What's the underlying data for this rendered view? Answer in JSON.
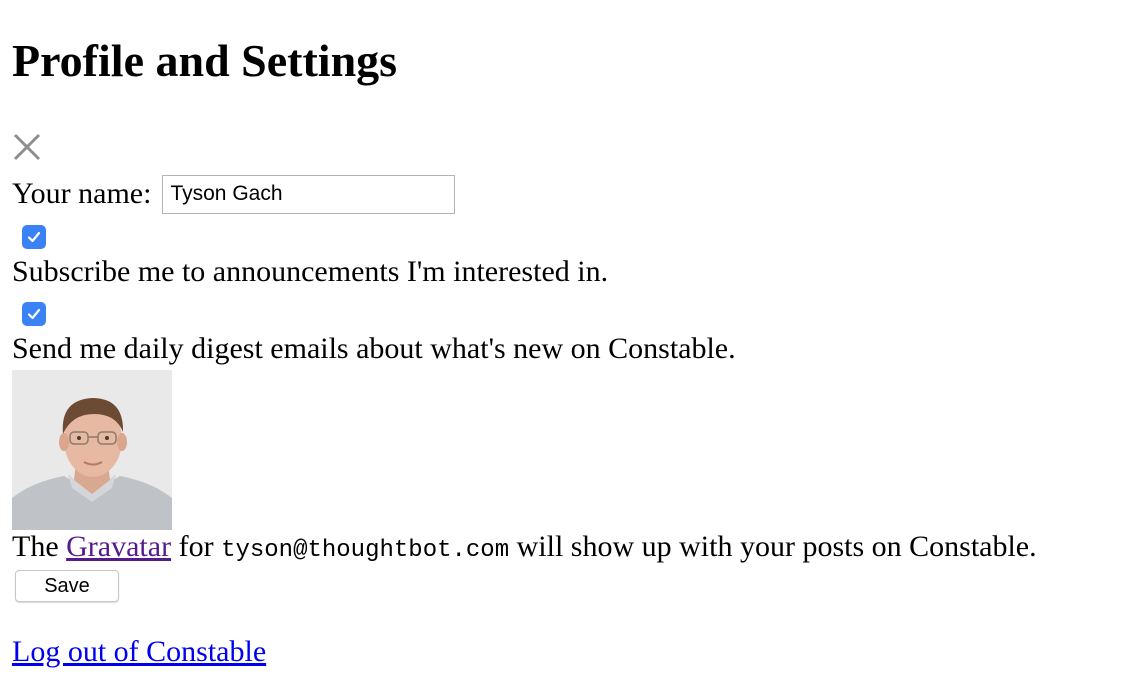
{
  "page": {
    "title": "Profile and Settings"
  },
  "close": {
    "icon": "close-icon"
  },
  "profile_form": {
    "name_label": "Your name:",
    "name_value": "Tyson Gach",
    "announcements_checked": true,
    "announcements_label": "Subscribe me to announcements I'm interested in.",
    "digest_checked": true,
    "digest_label": "Send me daily digest emails about what's new on Constable.",
    "avatar_alt": "avatar",
    "gravatar_prefix": "The",
    "gravatar_link": "Gravatar",
    "gravatar_middle": "for",
    "email": "tyson@thoughtbot.com",
    "gravatar_suffix": "will show up with your posts on Constable.",
    "save_label": "Save"
  },
  "logout": {
    "label": "Log out of Constable"
  },
  "colors": {
    "checkbox_accent": "#3a82f6",
    "visited_link": "#551a8b",
    "link": "#0000ee",
    "close_icon": "#8e8e8e"
  }
}
